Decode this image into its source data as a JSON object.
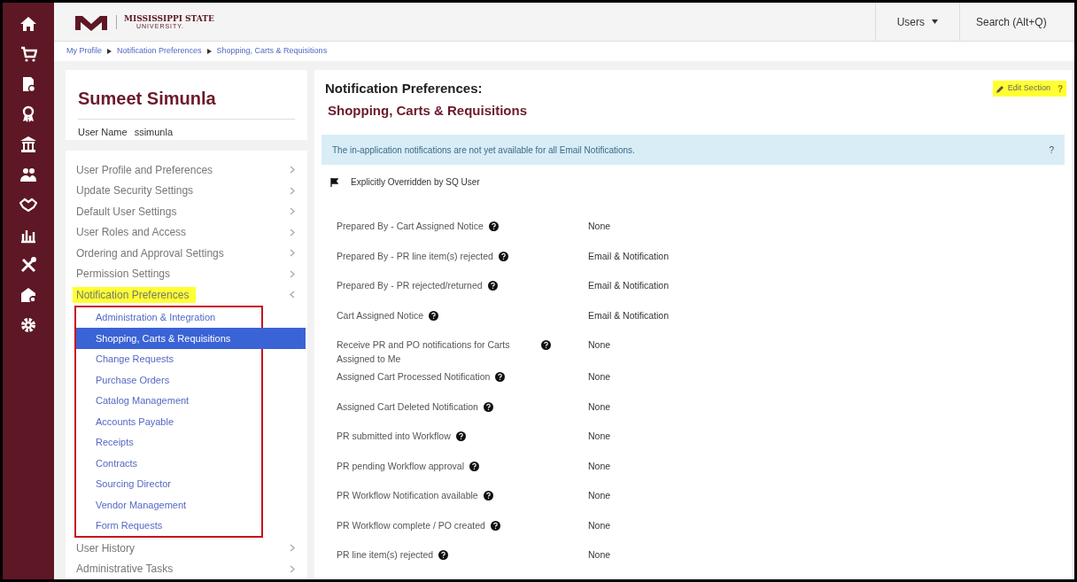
{
  "logo": {
    "name": "MISSISSIPPI STATE",
    "subtitle": "UNIVERSITY."
  },
  "header": {
    "users_menu": "Users",
    "search": "Search (Alt+Q)"
  },
  "breadcrumb": [
    "My Profile",
    "Notification Preferences",
    "Shopping, Carts & Requisitions"
  ],
  "profile": {
    "name": "Sumeet Simunla",
    "username_label": "User Name",
    "username": "ssimunla"
  },
  "nav_items": [
    {
      "label": "User Profile and Preferences",
      "expanded": false,
      "highlighted": false
    },
    {
      "label": "Update Security Settings",
      "expanded": false,
      "highlighted": false
    },
    {
      "label": "Default User Settings",
      "expanded": false,
      "highlighted": false
    },
    {
      "label": "User Roles and Access",
      "expanded": false,
      "highlighted": false
    },
    {
      "label": "Ordering and Approval Settings",
      "expanded": false,
      "highlighted": false
    },
    {
      "label": "Permission Settings",
      "expanded": false,
      "highlighted": false
    },
    {
      "label": "Notification Preferences",
      "expanded": true,
      "highlighted": true,
      "children": [
        {
          "label": "Administration & Integration",
          "selected": false
        },
        {
          "label": "Shopping, Carts & Requisitions",
          "selected": true
        },
        {
          "label": "Change Requests",
          "selected": false
        },
        {
          "label": "Purchase Orders",
          "selected": false
        },
        {
          "label": "Catalog Management",
          "selected": false
        },
        {
          "label": "Accounts Payable",
          "selected": false
        },
        {
          "label": "Receipts",
          "selected": false
        },
        {
          "label": "Contracts",
          "selected": false
        },
        {
          "label": "Sourcing Director",
          "selected": false
        },
        {
          "label": "Vendor Management",
          "selected": false
        },
        {
          "label": "Form Requests",
          "selected": false
        }
      ]
    },
    {
      "label": "User History",
      "expanded": false,
      "highlighted": false
    },
    {
      "label": "Administrative Tasks",
      "expanded": false,
      "highlighted": false
    }
  ],
  "main": {
    "title": "Notification Preferences:",
    "subtitle": "Shopping, Carts & Requisitions",
    "edit_button": {
      "label": "Edit Section",
      "highlighted": true
    },
    "help": "?",
    "info": {
      "text": "The in-application notifications are not yet available for all Email Notifications.",
      "help": "?"
    },
    "legend": "Explicitly Overridden by SQ User",
    "settings": [
      {
        "label": "Prepared By - Cart Assigned Notice",
        "value": "None"
      },
      {
        "label": "Prepared By - PR line item(s) rejected",
        "value": "Email & Notification"
      },
      {
        "label": "Prepared By - PR rejected/returned",
        "value": "Email & Notification"
      },
      {
        "label": "Cart Assigned Notice",
        "value": "Email & Notification"
      },
      {
        "label": "Receive PR and PO notifications for Carts Assigned to Me",
        "value": "None"
      },
      {
        "label": "Assigned Cart Processed Notification",
        "value": "None"
      },
      {
        "label": "Assigned Cart Deleted Notification",
        "value": "None"
      },
      {
        "label": "PR submitted into Workflow",
        "value": "None"
      },
      {
        "label": "PR pending Workflow approval",
        "value": "None"
      },
      {
        "label": "PR Workflow Notification available",
        "value": "None"
      },
      {
        "label": "PR Workflow complete / PO created",
        "value": "None"
      },
      {
        "label": "PR line item(s) rejected",
        "value": "None"
      }
    ]
  }
}
